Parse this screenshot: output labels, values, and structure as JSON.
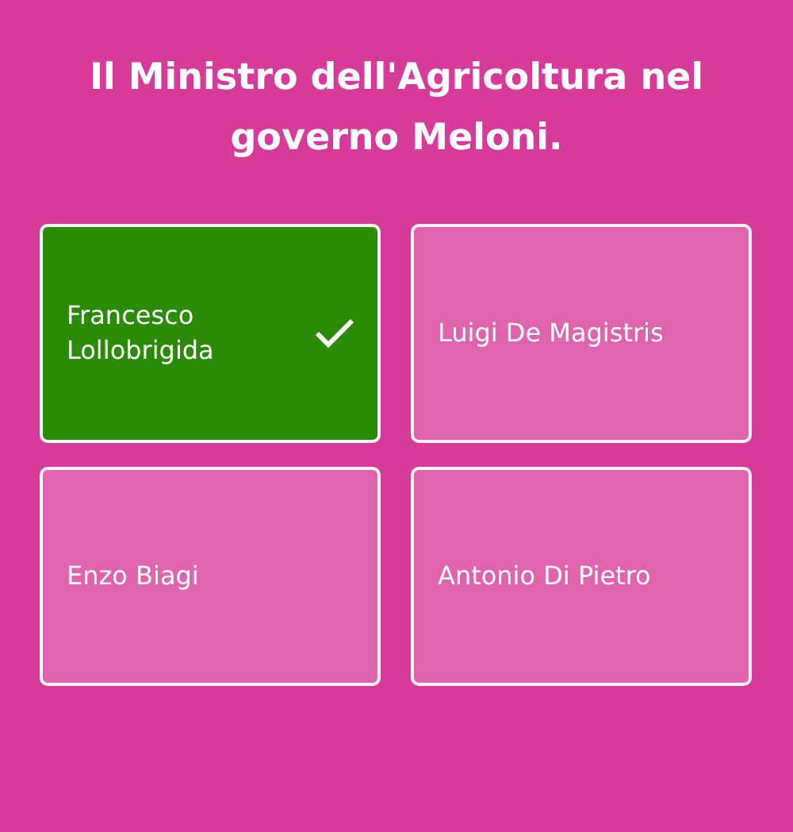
{
  "question": "Il Ministro dell'Agricoltura nel governo Meloni.",
  "answers": [
    {
      "label": "Francesco Lollobrigida",
      "correct": true
    },
    {
      "label": "Luigi De Magistris",
      "correct": false
    },
    {
      "label": "Enzo Biagi",
      "correct": false
    },
    {
      "label": "Antonio Di Pietro",
      "correct": false
    }
  ]
}
